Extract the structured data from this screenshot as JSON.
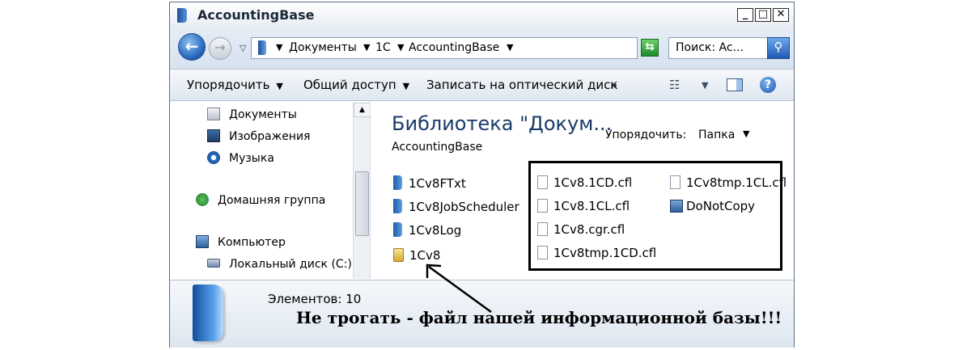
{
  "window": {
    "title": "AccountingBase",
    "min_symbol": "_",
    "max_symbol": "□",
    "close_symbol": "✕"
  },
  "address": {
    "crumbs": [
      "Документы",
      "1С",
      "AccountingBase"
    ],
    "search_value": "Поиск: Ac..."
  },
  "toolbar": {
    "organize": "Упорядочить",
    "share": "Общий доступ",
    "burn": "Записать на оптический диск",
    "more": "»"
  },
  "nav": {
    "items": [
      {
        "label": "Документы",
        "icon": "documents-icon"
      },
      {
        "label": "Изображения",
        "icon": "pictures-icon"
      },
      {
        "label": "Музыка",
        "icon": "music-icon"
      },
      {
        "label": "Домашняя группа",
        "icon": "homegroup-icon"
      },
      {
        "label": "Компьютер",
        "icon": "computer-icon"
      },
      {
        "label": "Локальный диск (C:)",
        "icon": "drive-icon"
      }
    ]
  },
  "content": {
    "library_title": "Библиотека \"Докум...",
    "library_subtitle": "AccountingBase",
    "arrange_label": "Упорядочить:",
    "arrange_value": "Папка",
    "folders": [
      "1Cv8FTxt",
      "1Cv8JobScheduler",
      "1Cv8Log"
    ],
    "database_file": "1Cv8",
    "files_col1": [
      "1Cv8.1CD.cfl",
      "1Cv8.1CL.cfl",
      "1Cv8.cgr.cfl",
      "1Cv8tmp.1CD.cfl"
    ],
    "files_col2": [
      "1Cv8tmp.1CL.cfl",
      "DoNotCopy"
    ]
  },
  "details": {
    "count": "Элементов: 10"
  },
  "annotation": "Не трогать - файл нашей информационной базы!!!"
}
